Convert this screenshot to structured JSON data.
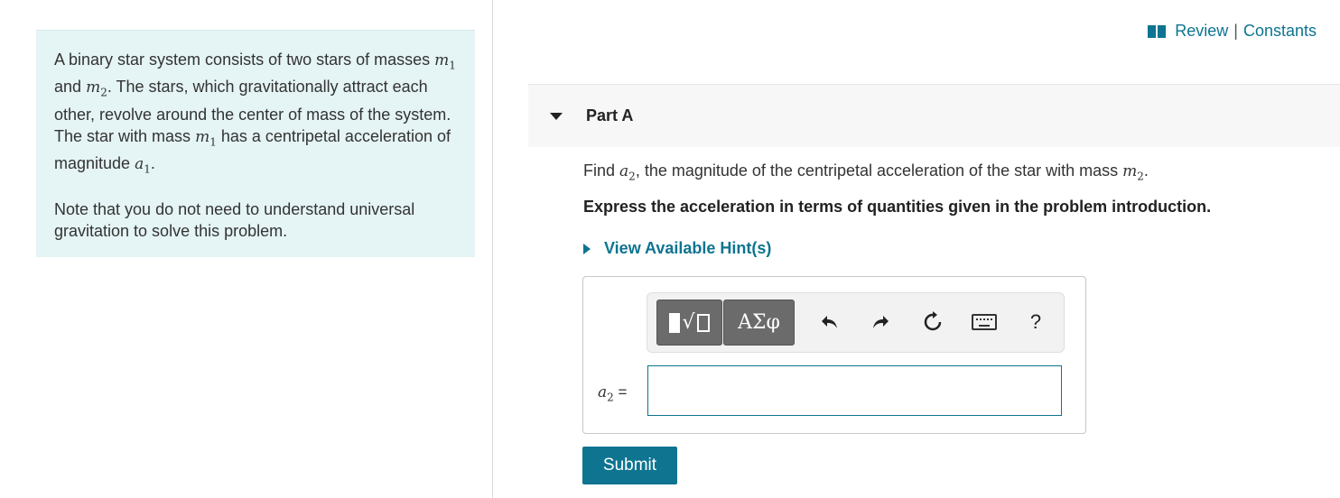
{
  "intro": {
    "p1_a": "A binary star system consists of two stars of masses",
    "p1_m1_var": "m",
    "p1_m1_sub": "1",
    "p1_b": "and",
    "p1_m2_var": "m",
    "p1_m2_sub": "2",
    "p1_c": ". The stars, which gravitationally attract each other, revolve around the center of mass of the system. The star with mass",
    "p1_m1b_var": "m",
    "p1_m1b_sub": "1",
    "p1_d": "has a centripetal acceleration of magnitude",
    "p1_a1_var": "a",
    "p1_a1_sub": "1",
    "p1_e": ".",
    "p2": "Note that you do not need to understand universal gravitation to solve this problem."
  },
  "top_links": {
    "review": "Review",
    "separator": "|",
    "constants": "Constants",
    "icon": "book-icon"
  },
  "part": {
    "title": "Part A"
  },
  "question": {
    "prefix": "Find",
    "var": "a",
    "var_sub": "2",
    "middle": ", the magnitude of the centripetal acceleration of the star with mass",
    "mass_var": "m",
    "mass_sub": "2",
    "suffix": "."
  },
  "instruction": "Express the acceleration in terms of quantities given in the problem introduction.",
  "hint": {
    "label": "View Available Hint(s)"
  },
  "toolbar": {
    "greek_label": "ΑΣφ",
    "help_label": "?",
    "icons": [
      "templates-icon",
      "greek-symbols-icon",
      "undo-icon",
      "redo-icon",
      "reset-icon",
      "keyboard-icon",
      "help-icon"
    ]
  },
  "answer": {
    "label_var": "a",
    "label_sub": "2",
    "label_eq": "=",
    "value": ""
  },
  "submit": {
    "label": "Submit"
  },
  "colors": {
    "accent": "#0e7490",
    "intro_bg": "#e5f4f5",
    "toolbar_btn": "#6b6b6b"
  }
}
